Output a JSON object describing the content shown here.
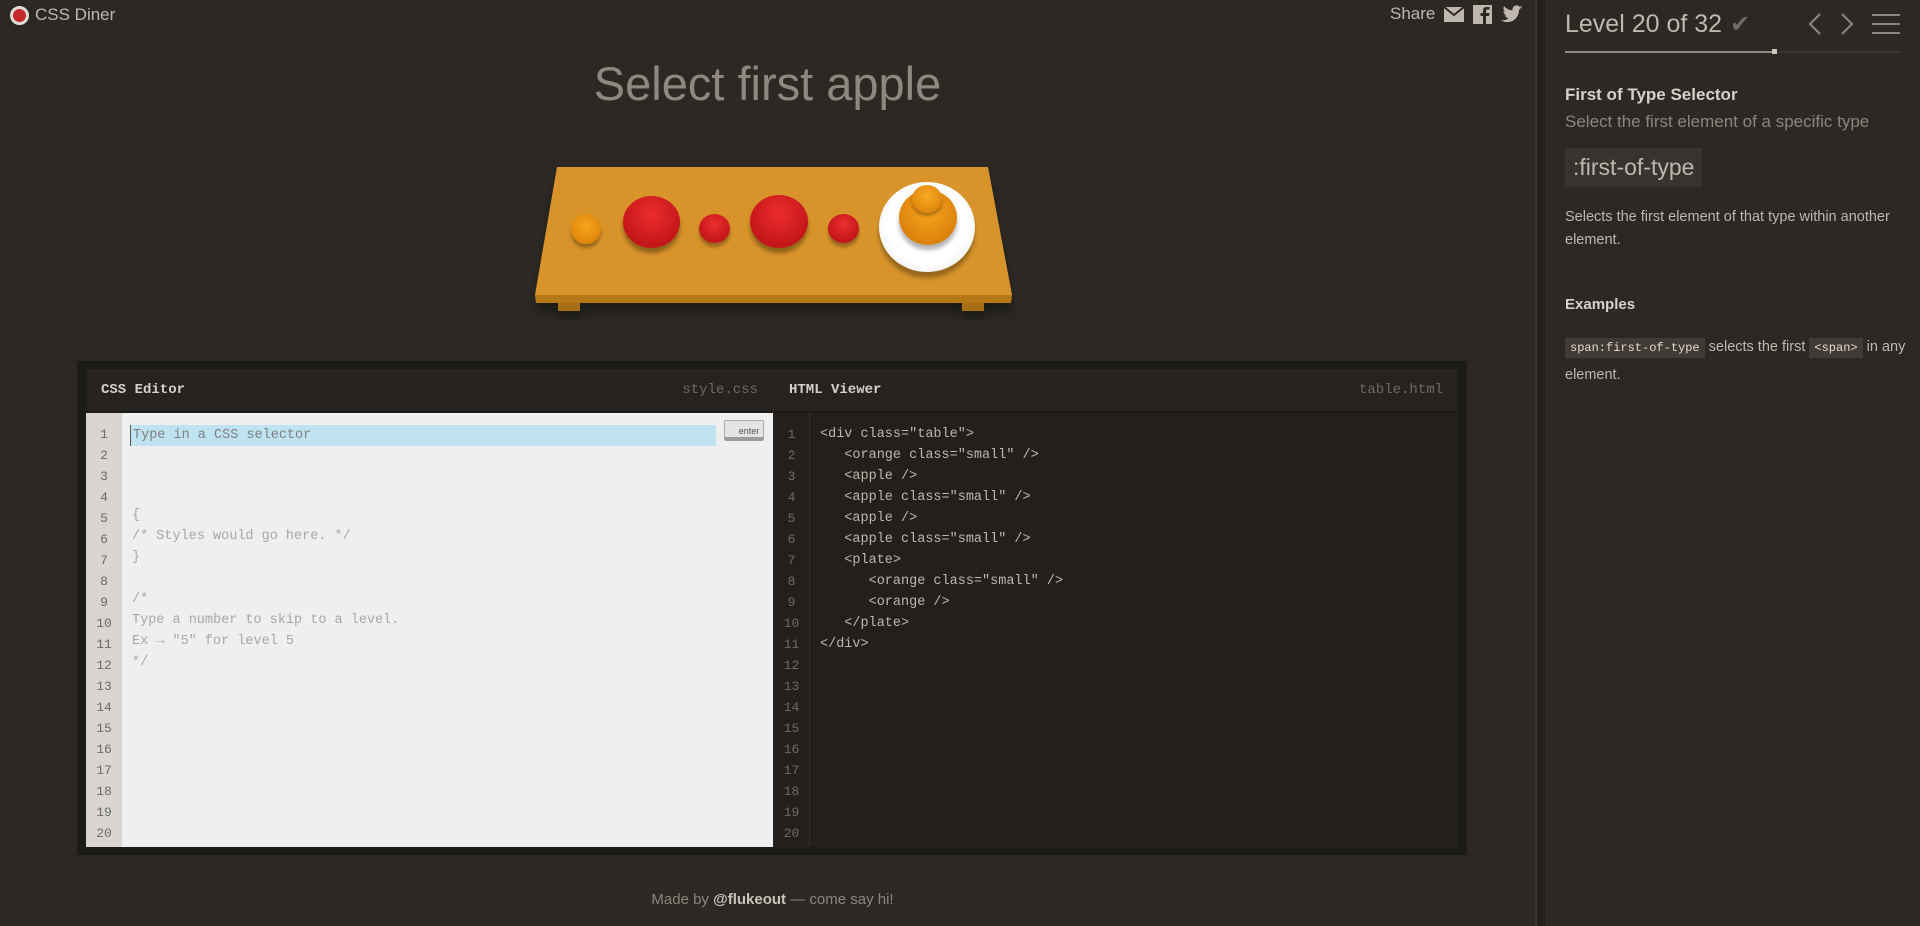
{
  "app": {
    "name": "CSS Diner"
  },
  "share": {
    "label": "Share"
  },
  "order": {
    "title": "Select first apple"
  },
  "editor": {
    "css_pane": {
      "title": "CSS Editor",
      "file": "style.css",
      "placeholder": "Type in a CSS selector",
      "enter_label": "enter",
      "lines": [
        "",
        "{",
        "/* Styles would go here. */",
        "}",
        "",
        "/*",
        "Type a number to skip to a level.",
        "Ex → \"5\" for level 5",
        "*/",
        "",
        "",
        "",
        "",
        "",
        "",
        "",
        "",
        "",
        "",
        ""
      ]
    },
    "html_pane": {
      "title": "HTML Viewer",
      "file": "table.html",
      "lines": [
        "<div class=\"table\">",
        "   <orange class=\"small\" />",
        "   <apple />",
        "   <apple class=\"small\" />",
        "   <apple />",
        "   <apple class=\"small\" />",
        "   <plate>",
        "      <orange class=\"small\" />",
        "      <orange />",
        "   </plate>",
        "</div>",
        "",
        "",
        "",
        "",
        "",
        "",
        "",
        "",
        ""
      ]
    },
    "line_numbers": [
      "1",
      "2",
      "3",
      "4",
      "5",
      "6",
      "7",
      "8",
      "9",
      "10",
      "11",
      "12",
      "13",
      "14",
      "15",
      "16",
      "17",
      "18",
      "19",
      "20"
    ]
  },
  "footer": {
    "prefix": "Made by ",
    "handle": "@flukeout",
    "suffix": " — come say hi!"
  },
  "sidebar": {
    "level_label": "Level 20 of 32",
    "progress": 0.625,
    "selector_name": "First of Type Selector",
    "title": "Select the first element of a specific type",
    "syntax": ":first-of-type",
    "hint": "Selects the first element of that type within another element.",
    "examples_title": "Examples",
    "example": {
      "code1": "span:first-of-type",
      "text1": " selects the first ",
      "code2": "<span>",
      "text2": " in any element."
    }
  },
  "colors": {
    "accent": "#c52828",
    "table": "#d8942c",
    "apple": "#d8151b",
    "orange": "#f09b0c",
    "plate": "#ffffff"
  }
}
